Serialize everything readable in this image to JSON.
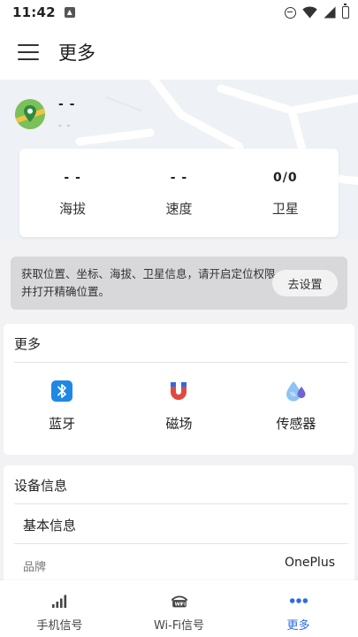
{
  "status": {
    "time": "11:42"
  },
  "appbar": {
    "title": "更多"
  },
  "location": {
    "line1": "- -",
    "line2": "- -"
  },
  "gps": [
    {
      "value": "- -",
      "label": "海拔"
    },
    {
      "value": "- -",
      "label": "速度"
    },
    {
      "value": "0/0",
      "label": "卫星"
    }
  ],
  "permission": {
    "text": "获取位置、坐标、海拔、卫星信息，请开启定位权限并打开精确位置。",
    "button": "去设置"
  },
  "more": {
    "header": "更多",
    "tools": [
      {
        "label": "蓝牙",
        "icon": "bluetooth-icon"
      },
      {
        "label": "磁场",
        "icon": "magnet-icon"
      },
      {
        "label": "传感器",
        "icon": "sensor-icon"
      }
    ]
  },
  "device": {
    "header": "设备信息",
    "basic": "基本信息",
    "brand_label": "品牌",
    "brand_value": "OnePlus"
  },
  "nav": [
    {
      "label": "手机信号",
      "icon": "signal-bars-icon"
    },
    {
      "label": "Wi-Fi信号",
      "icon": "wifi-badge-icon"
    },
    {
      "label": "更多",
      "icon": "more-dots-icon"
    }
  ],
  "colors": {
    "accent": "#2b6be6",
    "bluetooth": "#1e88e5",
    "magnet_red": "#e04a3f",
    "magnet_blue": "#2b6be6",
    "sensor_light": "#8fc3f2",
    "sensor_dark": "#6f63d6"
  }
}
